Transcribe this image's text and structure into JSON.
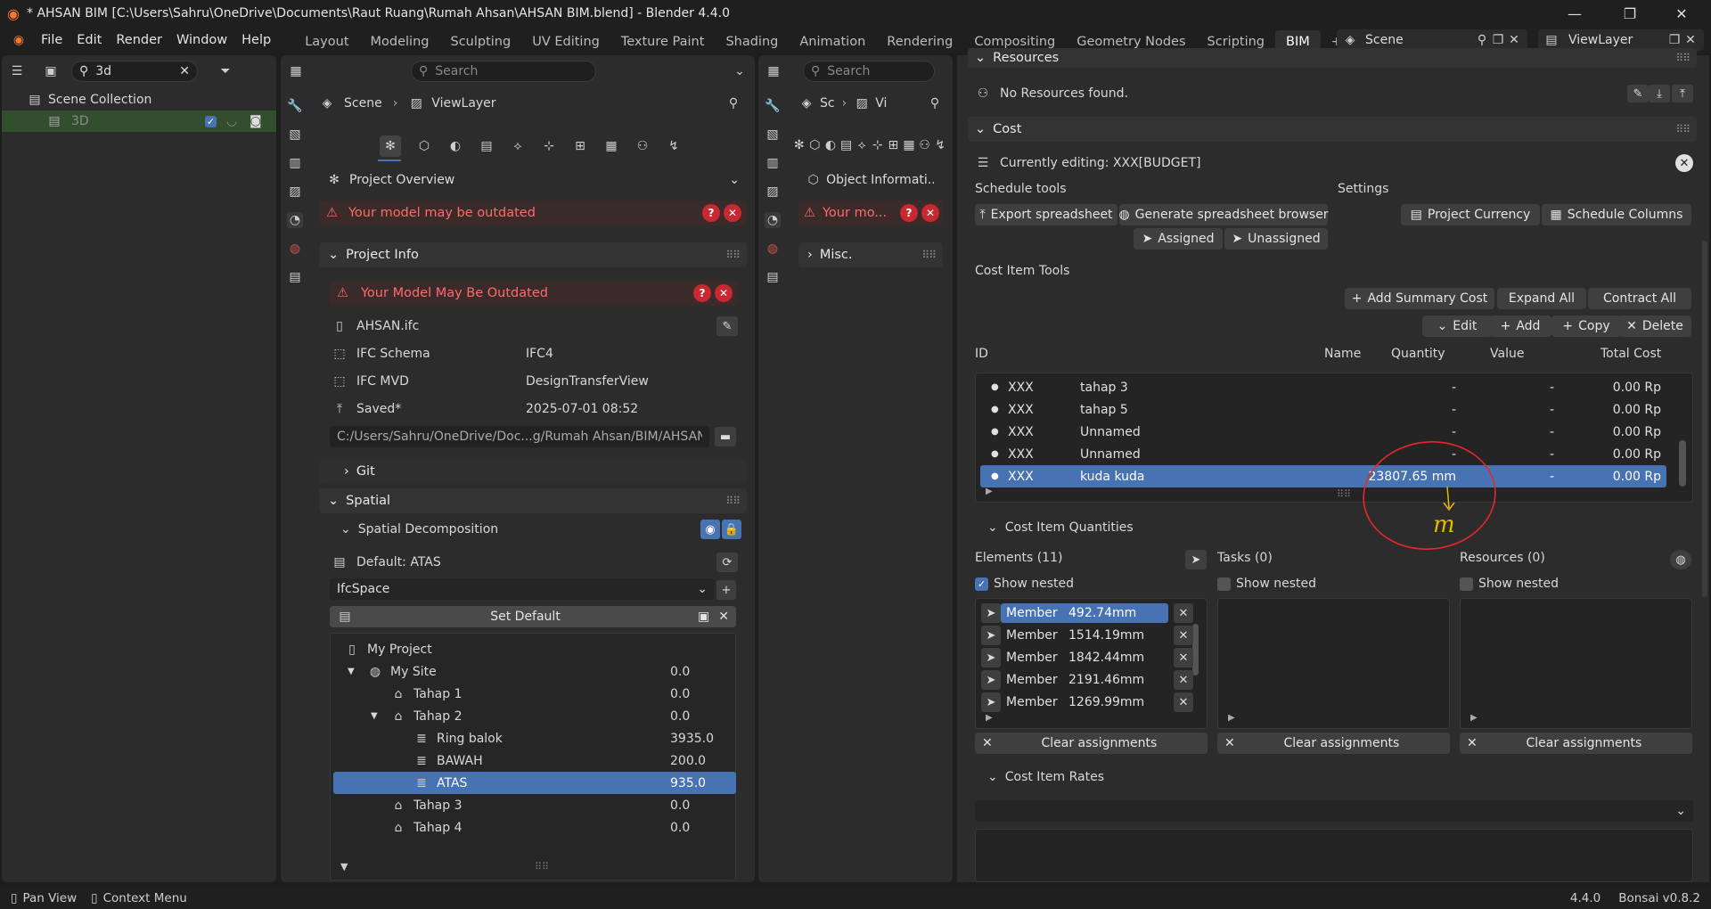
{
  "window": {
    "title": "* AHSAN BIM [C:\\Users\\Sahru\\OneDrive\\Documents\\Raut Ruang\\Rumah Ahsan\\AHSAN BIM.blend] - Blender 4.4.0"
  },
  "menu": {
    "items": [
      "File",
      "Edit",
      "Render",
      "Window",
      "Help"
    ]
  },
  "workspaces": [
    "Layout",
    "Modeling",
    "Sculpting",
    "UV Editing",
    "Texture Paint",
    "Shading",
    "Animation",
    "Rendering",
    "Compositing",
    "Geometry Nodes",
    "Scripting",
    "BIM"
  ],
  "header_right": {
    "scene": "Scene",
    "viewlayer": "ViewLayer"
  },
  "outliner": {
    "search_value": "3d",
    "collection": "Scene Collection",
    "item": "3D"
  },
  "props": {
    "search_placeholder": "Search",
    "breadcrumb": [
      "Scene",
      "ViewLayer"
    ],
    "overview": "Project Overview",
    "warning": "Your model may be outdated",
    "project_info": "Project Info",
    "warning2": "Your Model May Be Outdated",
    "file": "AHSAN.ifc",
    "schema_label": "IFC Schema",
    "schema_value": "IFC4",
    "mvd_label": "IFC MVD",
    "mvd_value": "DesignTransferView",
    "saved_label": "Saved*",
    "saved_value": "2025-07-01 08:52",
    "path": "C:/Users/Sahru/OneDrive/Doc...g/Rumah Ahsan/BIM/AHSAN.ifc",
    "git": "Git",
    "spatial": "Spatial",
    "spatial_decomp": "Spatial Decomposition",
    "default": "Default: ATAS",
    "ifc_class": "IfcSpace",
    "set_default": "Set Default",
    "tree": [
      {
        "label": "My Project",
        "value": "",
        "indent": 0,
        "icon": "project"
      },
      {
        "label": "My Site",
        "value": "0.0",
        "indent": 1,
        "icon": "site",
        "arrow": "▼"
      },
      {
        "label": "Tahap 1",
        "value": "0.0",
        "indent": 2,
        "icon": "home"
      },
      {
        "label": "Tahap 2",
        "value": "0.0",
        "indent": 2,
        "icon": "home",
        "arrow": "▼"
      },
      {
        "label": "Ring balok",
        "value": "3935.0",
        "indent": 3,
        "icon": "storey"
      },
      {
        "label": "BAWAH",
        "value": "200.0",
        "indent": 3,
        "icon": "storey"
      },
      {
        "label": "ATAS",
        "value": "935.0",
        "indent": 3,
        "icon": "storey",
        "selected": true
      },
      {
        "label": "Tahap 3",
        "value": "0.0",
        "indent": 2,
        "icon": "home"
      },
      {
        "label": "Tahap 4",
        "value": "0.0",
        "indent": 2,
        "icon": "home"
      }
    ]
  },
  "props2": {
    "search_placeholder": "Search",
    "breadcrumb": [
      "Sc",
      "Vi"
    ],
    "object_info": "Object Informati...",
    "warning": "Your mo...",
    "misc": "Misc."
  },
  "bim": {
    "resources": "Resources",
    "no_resources": "No Resources found.",
    "cost": "Cost",
    "editing": "Currently editing: XXX[BUDGET]",
    "schedule_tools": "Schedule tools",
    "settings": "Settings",
    "export": "Export spreadsheet",
    "generate": "Generate spreadsheet browser",
    "project_currency": "Project Currency",
    "schedule_columns": "Schedule Columns",
    "assigned": "Assigned",
    "unassigned": "Unassigned",
    "cost_item_tools": "Cost Item Tools",
    "add_summary": "Add Summary Cost",
    "expand_all": "Expand All",
    "contract_all": "Contract All",
    "edit": "Edit",
    "add": "Add",
    "copy": "Copy",
    "delete": "Delete",
    "columns": [
      "ID",
      "Name",
      "Quantity",
      "Value",
      "Total Cost"
    ],
    "rows": [
      {
        "id": "XXX",
        "name": "tahap 3",
        "qty": "-",
        "value": "-",
        "total": "0.00 Rp"
      },
      {
        "id": "XXX",
        "name": "tahap 5",
        "qty": "-",
        "value": "-",
        "total": "0.00 Rp"
      },
      {
        "id": "XXX",
        "name": "Unnamed",
        "qty": "-",
        "value": "-",
        "total": "0.00 Rp"
      },
      {
        "id": "XXX",
        "name": "Unnamed",
        "qty": "-",
        "value": "-",
        "total": "0.00 Rp"
      },
      {
        "id": "XXX",
        "name": "kuda kuda",
        "qty": "23807.65 mm",
        "value": "-",
        "total": "0.00 Rp",
        "selected": true
      }
    ],
    "quantities": "Cost Item Quantities",
    "elements": "Elements (11)",
    "tasks": "Tasks (0)",
    "resources_count": "Resources (0)",
    "show_nested": "Show nested",
    "element_rows": [
      {
        "type": "Member",
        "qty": "492.74mm",
        "selected": true
      },
      {
        "type": "Member",
        "qty": "1514.19mm"
      },
      {
        "type": "Member",
        "qty": "1842.44mm"
      },
      {
        "type": "Member",
        "qty": "2191.46mm"
      },
      {
        "type": "Member",
        "qty": "1269.99mm"
      }
    ],
    "clear": "Clear assignments",
    "rates": "Cost Item Rates",
    "annotation": "m"
  },
  "status": {
    "pan": "Pan View",
    "context": "Context Menu",
    "version": "4.4.0",
    "bonsai": "Bonsai v0.8.2"
  }
}
